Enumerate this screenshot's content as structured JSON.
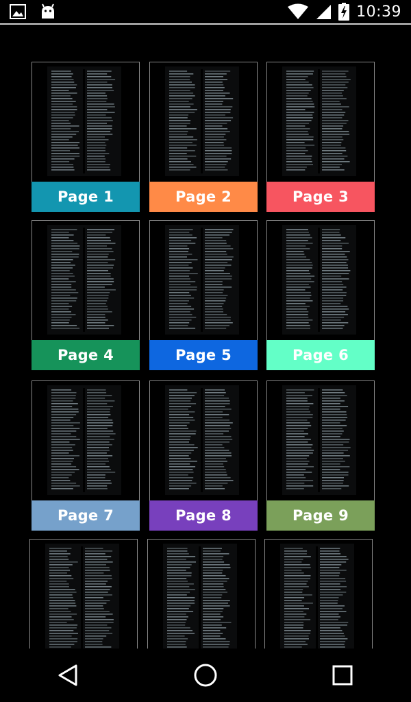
{
  "status_bar": {
    "time": "10:39",
    "left_icons": [
      "image-icon",
      "android-icon"
    ],
    "right_icons": [
      "wifi-icon",
      "signal-icon",
      "battery-charging-icon"
    ]
  },
  "pages": [
    {
      "label": "Page 1",
      "color": "#1396b0"
    },
    {
      "label": "Page 2",
      "color": "#ff8a47"
    },
    {
      "label": "Page 3",
      "color": "#f75560"
    },
    {
      "label": "Page 4",
      "color": "#16935a"
    },
    {
      "label": "Page 5",
      "color": "#0e67e0"
    },
    {
      "label": "Page 6",
      "color": "#63ffc7"
    },
    {
      "label": "Page 7",
      "color": "#76a1cb"
    },
    {
      "label": "Page 8",
      "color": "#7840bd"
    },
    {
      "label": "Page 9",
      "color": "#7ba05a"
    }
  ],
  "partial_row_count": 3,
  "nav_bar": {
    "buttons": [
      "back-icon",
      "home-icon",
      "recents-icon"
    ]
  }
}
